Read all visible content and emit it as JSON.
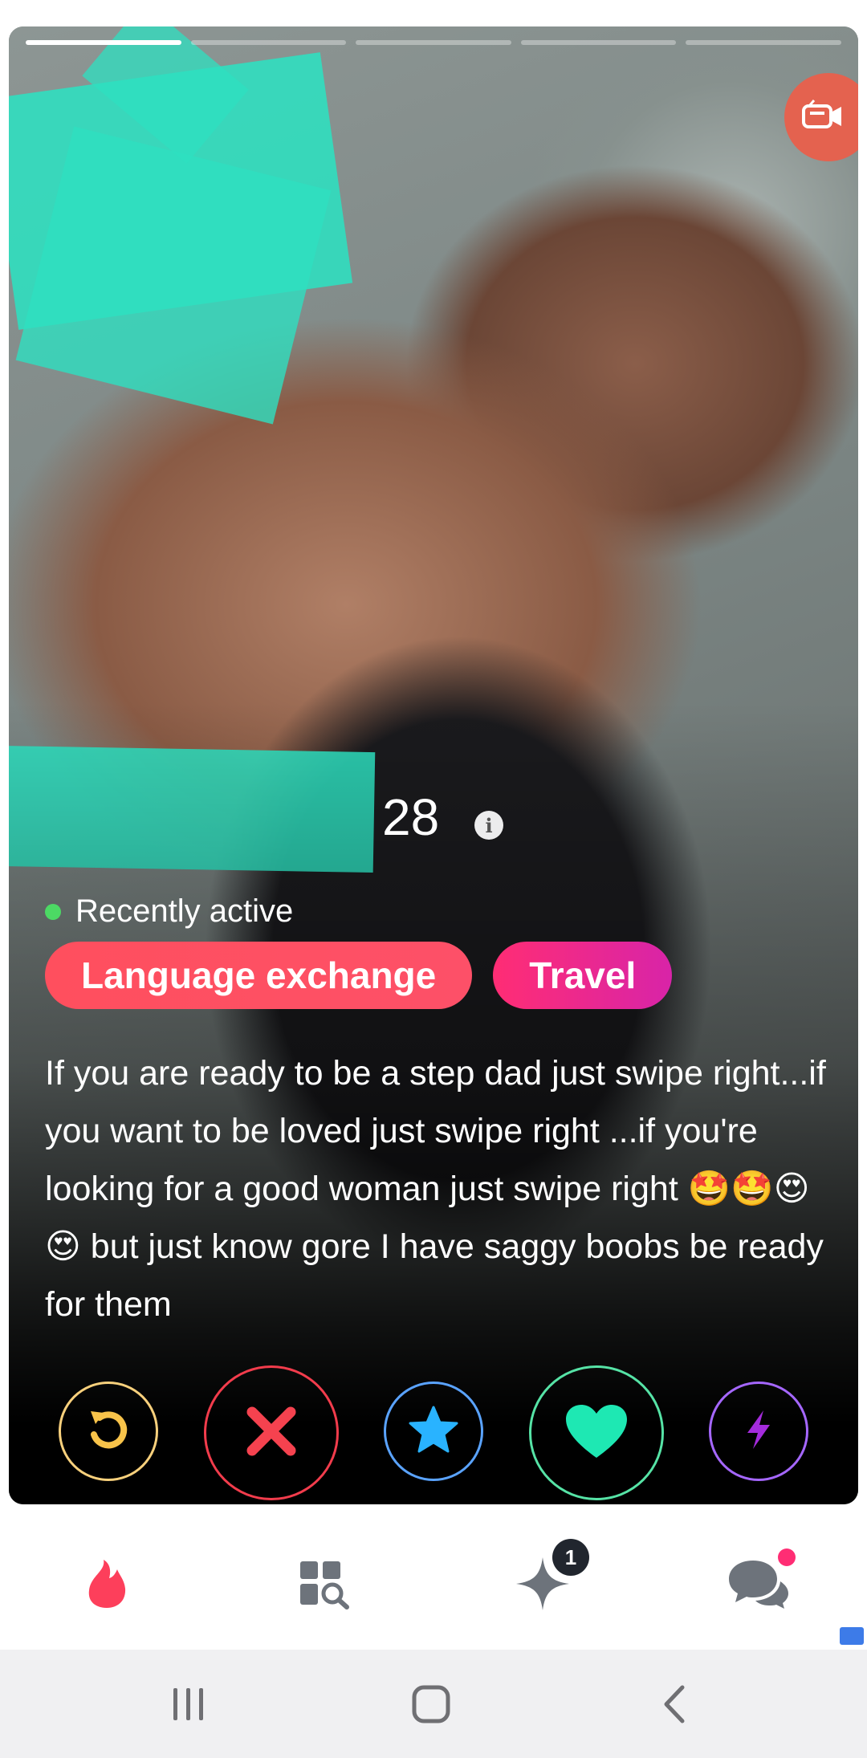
{
  "profile": {
    "age": "28",
    "status": "Recently active",
    "tags": [
      "Language exchange",
      "Travel"
    ],
    "bio": "If you are ready to be a step dad just swipe right...if you want to be loved just swipe right ...if you're looking for a good woman just swipe right  🤩🤩😍😍 but just know gore I have saggy boobs be ready for them",
    "photo_count": 5,
    "current_photo": 1
  },
  "actions": {
    "rewind": "rewind-icon",
    "nope": "close-icon",
    "super_like": "star-icon",
    "like": "heart-icon",
    "boost": "lightning-icon"
  },
  "bottom_nav": {
    "items": [
      "flame-icon",
      "explore-icon",
      "gold-sparkle-icon",
      "chat-icon"
    ],
    "likes_badge": "1"
  },
  "colors": {
    "brand": "#fd5068",
    "rewind": "#f8d07c",
    "nope": "#f23c4c",
    "super_like": "#5aa3ff",
    "like": "#56e3a6",
    "boost": "#a567ff"
  }
}
